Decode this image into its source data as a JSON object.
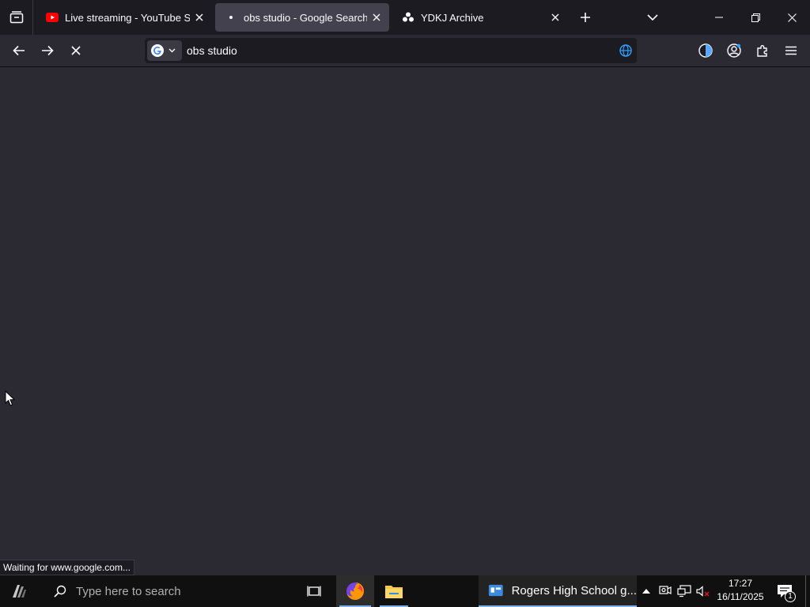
{
  "browser": {
    "tabs": [
      {
        "title": "Live streaming - YouTube Studio",
        "favicon": "youtube-icon",
        "active": false
      },
      {
        "title": "obs studio - Google Search",
        "favicon": "loading-dot-icon",
        "active": true
      },
      {
        "title": "YDKJ Archive",
        "favicon": "site-icon",
        "active": false
      }
    ],
    "url_value": "obs studio",
    "status_text": "Waiting for www.google.com...",
    "colors": {
      "accent_youtube": "#ff0000",
      "globe": "#2ea2ff",
      "tab_active": "#42414d"
    }
  },
  "taskbar": {
    "search_placeholder": "Type here to search",
    "window_title": "Rogers High School g...",
    "time": "17:27",
    "date": "16/11/2025",
    "notification_count": "1"
  }
}
